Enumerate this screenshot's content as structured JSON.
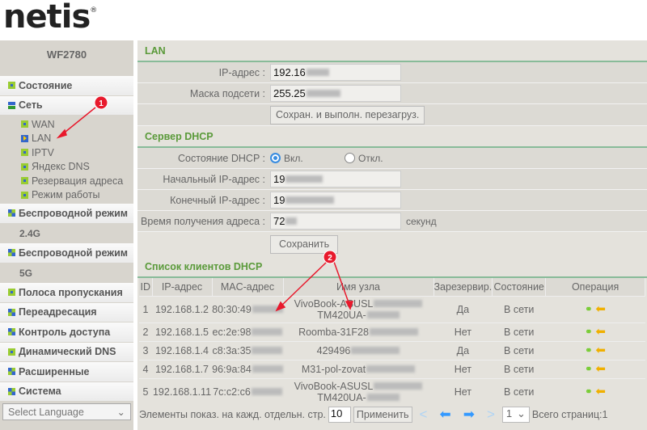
{
  "brand": "netis",
  "sidebar": {
    "model": "WF2780",
    "items": [
      {
        "label": "Состояние"
      },
      {
        "label": "Сеть"
      },
      {
        "label": "Беспроводной режим"
      },
      {
        "label": "Беспроводной режим"
      },
      {
        "label": "Полоса пропускания"
      },
      {
        "label": "Переадресация"
      },
      {
        "label": "Контроль доступа"
      },
      {
        "label": "Динамический DNS"
      },
      {
        "label": "Расширенные"
      },
      {
        "label": "Система"
      }
    ],
    "network_sub": [
      "WAN",
      "LAN",
      "IPTV",
      "Яндекс DNS",
      "Резервация адреса",
      "Режим работы"
    ],
    "band1": "2.4G",
    "band2": "5G",
    "language": "Select Language"
  },
  "lan": {
    "title": "LAN",
    "ip_label": "IP-адрес :",
    "ip_value": "192.16",
    "mask_label": "Маска подсети :",
    "mask_value": "255.25",
    "save_reboot": "Сохран. и выполн. перезагруз."
  },
  "dhcp": {
    "title": "Сервер DHCP",
    "state_label": "Состояние DHCP :",
    "on": "Вкл.",
    "off": "Откл.",
    "selected": "on",
    "start_label": "Начальный IP-адрес :",
    "start_value": "19",
    "end_label": "Конечный IP-адрес :",
    "end_value": "19",
    "lease_label": "Время получения адреса :",
    "lease_value": "72",
    "lease_unit": "секунд",
    "save": "Сохранить"
  },
  "clients": {
    "title": "Список клиентов DHCP",
    "headers": [
      "ID",
      "IP-адрес",
      "MAC-адрес",
      "Имя узла",
      "Зарезервир.",
      "Состояние",
      "Операция"
    ],
    "rows": [
      {
        "id": "1",
        "ip": "192.168.1.2",
        "mac": "80:30:49",
        "host": "VivoBook-ASUSL",
        "host2": "TM420UA-",
        "res": "Да",
        "state": "В сети"
      },
      {
        "id": "2",
        "ip": "192.168.1.5",
        "mac": "ec:2e:98",
        "host": "Roomba-31F28",
        "host2": "",
        "res": "Нет",
        "state": "В сети"
      },
      {
        "id": "3",
        "ip": "192.168.1.4",
        "mac": "c8:3a:35",
        "host": "429496",
        "host2": "",
        "res": "Да",
        "state": "В сети"
      },
      {
        "id": "4",
        "ip": "192.168.1.7",
        "mac": "96:9a:84",
        "host": "M31-pol-zovat",
        "host2": "",
        "res": "Нет",
        "state": "В сети"
      },
      {
        "id": "5",
        "ip": "192.168.1.11",
        "mac": "7c:c2:c6",
        "host": "VivoBook-ASUSL",
        "host2": "TM420UA-",
        "res": "Нет",
        "state": "В сети"
      }
    ],
    "per_page_label": "Элементы показ. на кажд. отдельн. стр.",
    "per_page": "10",
    "apply": "Применить",
    "page": "1",
    "total": "Всего страниц:1"
  },
  "annotations": [
    "1",
    "2"
  ],
  "colors": {
    "accent": "#5a9a3a",
    "annotation": "#e8192c"
  }
}
